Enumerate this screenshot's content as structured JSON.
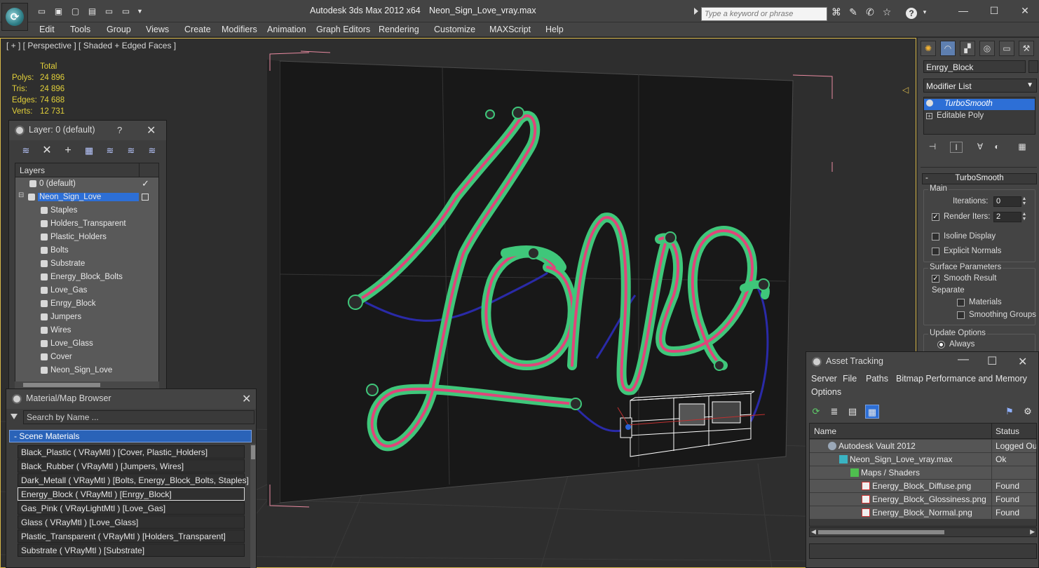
{
  "titlebar": {
    "app_title": "Autodesk 3ds Max  2012 x64",
    "file_title": "Neon_Sign_Love_vray.max",
    "search_placeholder": "Type a keyword or phrase"
  },
  "menu": [
    "Edit",
    "Tools",
    "Group",
    "Views",
    "Create",
    "Modifiers",
    "Animation",
    "Graph Editors",
    "Rendering",
    "Customize",
    "MAXScript",
    "Help"
  ],
  "viewport": {
    "label": "[ + ] [ Perspective ] [ Shaded + Edged Faces ]",
    "stats_header": "Total",
    "stats": [
      {
        "key": "Polys:",
        "value": "24 896"
      },
      {
        "key": "Tris:",
        "value": "24 896"
      },
      {
        "key": "Edges:",
        "value": "74 688"
      },
      {
        "key": "Verts:",
        "value": "12 731"
      }
    ],
    "colors": {
      "neon_green": "#3fc77a",
      "neon_pink": "#e0457a",
      "wire_blue": "#2a2aa8",
      "board": "#1a1a1a",
      "bbox_pink": "#e88aa0",
      "selection": "#d8b84a"
    }
  },
  "layer_explorer": {
    "title": "Layer: 0 (default)",
    "help": "?",
    "column_header": "Layers",
    "layers": [
      {
        "name": "0 (default)",
        "indent": 1,
        "kind": "layer",
        "checked": true
      },
      {
        "name": "Neon_Sign_Love",
        "indent": 0,
        "kind": "layer",
        "selected": true
      },
      {
        "name": "Staples",
        "indent": 2,
        "kind": "object"
      },
      {
        "name": "Holders_Transparent",
        "indent": 2,
        "kind": "object"
      },
      {
        "name": "Plastic_Holders",
        "indent": 2,
        "kind": "object"
      },
      {
        "name": "Bolts",
        "indent": 2,
        "kind": "object"
      },
      {
        "name": "Substrate",
        "indent": 2,
        "kind": "object"
      },
      {
        "name": "Energy_Block_Bolts",
        "indent": 2,
        "kind": "object"
      },
      {
        "name": "Love_Gas",
        "indent": 2,
        "kind": "object"
      },
      {
        "name": "Enrgy_Block",
        "indent": 2,
        "kind": "object"
      },
      {
        "name": "Jumpers",
        "indent": 2,
        "kind": "object"
      },
      {
        "name": "Wires",
        "indent": 2,
        "kind": "object"
      },
      {
        "name": "Love_Glass",
        "indent": 2,
        "kind": "object"
      },
      {
        "name": "Cover",
        "indent": 2,
        "kind": "object"
      },
      {
        "name": "Neon_Sign_Love",
        "indent": 2,
        "kind": "object"
      }
    ]
  },
  "material_browser": {
    "title": "Material/Map Browser",
    "search_placeholder": "Search by Name ...",
    "group": "- Scene Materials",
    "materials": [
      "Black_Plastic  ( VRayMtl ) [Cover, Plastic_Holders]",
      "Black_Rubber  ( VRayMtl ) [Jumpers, Wires]",
      "Dark_Metall  ( VRayMtl ) [Bolts, Energy_Block_Bolts, Staples]",
      "Energy_Block  ( VRayMtl ) [Enrgy_Block]",
      "Gas_Pink  ( VRayLightMtl ) [Love_Gas]",
      "Glass  ( VRayMtl ) [Love_Glass]",
      "Plastic_Transparent  ( VRayMtl ) [Holders_Transparent]",
      "Substrate  ( VRayMtl ) [Substrate]"
    ],
    "selected_index": 3
  },
  "command_panel": {
    "object_name": "Enrgy_Block",
    "modifier_list": "Modifier List",
    "stack": [
      {
        "name": "TurboSmooth",
        "selected": true
      },
      {
        "name": "Editable Poly",
        "selected": false
      }
    ],
    "rollout_title": "TurboSmooth",
    "main_group": "Main",
    "iterations_label": "Iterations:",
    "iterations_value": "0",
    "render_iters_label": "Render Iters:",
    "render_iters_value": "2",
    "render_iters_checked": true,
    "isoline_label": "Isoline Display",
    "explicit_label": "Explicit Normals",
    "surface_group": "Surface Parameters",
    "smooth_result_label": "Smooth Result",
    "smooth_result_checked": true,
    "separate_label": "Separate",
    "materials_label": "Materials",
    "smoothing_groups_label": "Smoothing Groups",
    "update_group": "Update Options",
    "always_label": "Always"
  },
  "asset_tracking": {
    "title": "Asset Tracking",
    "menu": [
      "Server",
      "File",
      "Paths",
      "Bitmap Performance and Memory",
      "Options"
    ],
    "col_name": "Name",
    "col_status": "Status",
    "rows": [
      {
        "name": "Autodesk Vault 2012",
        "status": "Logged Ou",
        "indent": 1,
        "icon": "vault-icon"
      },
      {
        "name": "Neon_Sign_Love_vray.max",
        "status": "Ok",
        "indent": 2,
        "icon": "max-file-icon"
      },
      {
        "name": "Maps / Shaders",
        "status": "",
        "indent": 3,
        "icon": "maps-icon"
      },
      {
        "name": "Energy_Block_Diffuse.png",
        "status": "Found",
        "indent": 4,
        "icon": "png-icon"
      },
      {
        "name": "Energy_Block_Glossiness.png",
        "status": "Found",
        "indent": 4,
        "icon": "png-icon"
      },
      {
        "name": "Energy_Block_Normal.png",
        "status": "Found",
        "indent": 4,
        "icon": "png-icon"
      }
    ]
  }
}
